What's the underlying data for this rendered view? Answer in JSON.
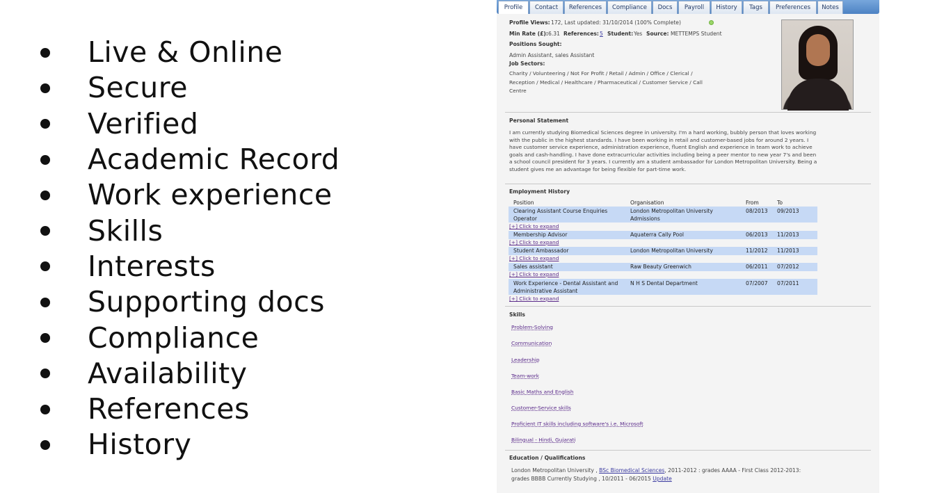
{
  "bullets": [
    "Live & Online",
    "Secure",
    "Verified",
    "Academic Record",
    "Work experience",
    "Skills",
    "Interests",
    "Supporting docs",
    "Compliance",
    "Availability",
    "References",
    "History"
  ],
  "tabs": [
    "Profile",
    "Contact",
    "References",
    "Compliance",
    "Docs",
    "Payroll",
    "History",
    "Tags",
    "Preferences",
    "Notes"
  ],
  "profile": {
    "views_label": "Profile Views:",
    "views_value": "172, Last updated: 31/10/2014 (100% Complete)",
    "min_rate_label": "Min Rate (£):",
    "min_rate_value": "6.31",
    "references_label": "References:",
    "references_value": "5",
    "student_label": "Student:",
    "student_value": "Yes",
    "source_label": "Source:",
    "source_value": "METTEMPS Student",
    "positions_label": "Positions Sought:",
    "positions_value": "Admin Assistant, sales Assistant",
    "sectors_label": "Job Sectors:",
    "sectors_value": "Charity / Volunteering / Not For Profit / Retail / Admin / Office / Clerical / Reception / Medical / Healthcare / Pharmaceutical / Customer Service / Call Centre",
    "status_color": "#9bd66a"
  },
  "statement": {
    "title": "Personal Statement",
    "text": "I am currently studying Biomedical Sciences degree in university. I'm a hard working, bubbly person that loves working with the public in the highest standards. I have been working in retail and customer-based jobs for around 2 years. I have customer service experience, administration experience, fluent English and experience in team work to achieve goals and cash-handling. I have done extracurricular activities including being a peer mentor to new year 7's and been a school council president for 3 years. I currently am a student ambassador for London Metropolitan University. Being a student gives me an advantage for being flexible for part-time work."
  },
  "employment": {
    "title": "Employment History",
    "headers": {
      "position": "Position",
      "organisation": "Organisation",
      "from": "From",
      "to": "To"
    },
    "expand_label": "[+] Click to expand",
    "rows": [
      {
        "position": "Clearing Assistant Course Enquiries Operator",
        "organisation": "London Metropolitan University Admissions",
        "from": "08/2013",
        "to": "09/2013"
      },
      {
        "position": "Membership Advisor",
        "organisation": "Aquaterra Cally Pool",
        "from": "06/2013",
        "to": "11/2013"
      },
      {
        "position": "Student Ambassador",
        "organisation": "London Metropolitan University",
        "from": "11/2012",
        "to": "11/2013"
      },
      {
        "position": "Sales assistant",
        "organisation": "Raw Beauty Greenwich",
        "from": "06/2011",
        "to": "07/2012"
      },
      {
        "position": "Work Experience - Dental Assistant and Administrative Assistant",
        "organisation": "N H S Dental Department",
        "from": "07/2007",
        "to": "07/2011"
      }
    ]
  },
  "skills": {
    "title": "Skills",
    "items": [
      "Problem-Solving",
      "Communication",
      "Leadership",
      "Team-work",
      "Basic Maths and English",
      "Customer-Service skills",
      "Proficient IT skills including software's i.e. Microsoft",
      "Bilingual - Hindi, Gujarati"
    ]
  },
  "education": {
    "title": "Education / Qualifications",
    "prefix": "London Metropolitan University ,",
    "course": "BSc Biomedical Sciences",
    "detail_1": ", 2011-2012 : grades AAAA - First Class 2012-2013:",
    "detail_2": "grades BBBB Currently Studying , 10/2011 - 06/2015",
    "update_label": "Update"
  }
}
